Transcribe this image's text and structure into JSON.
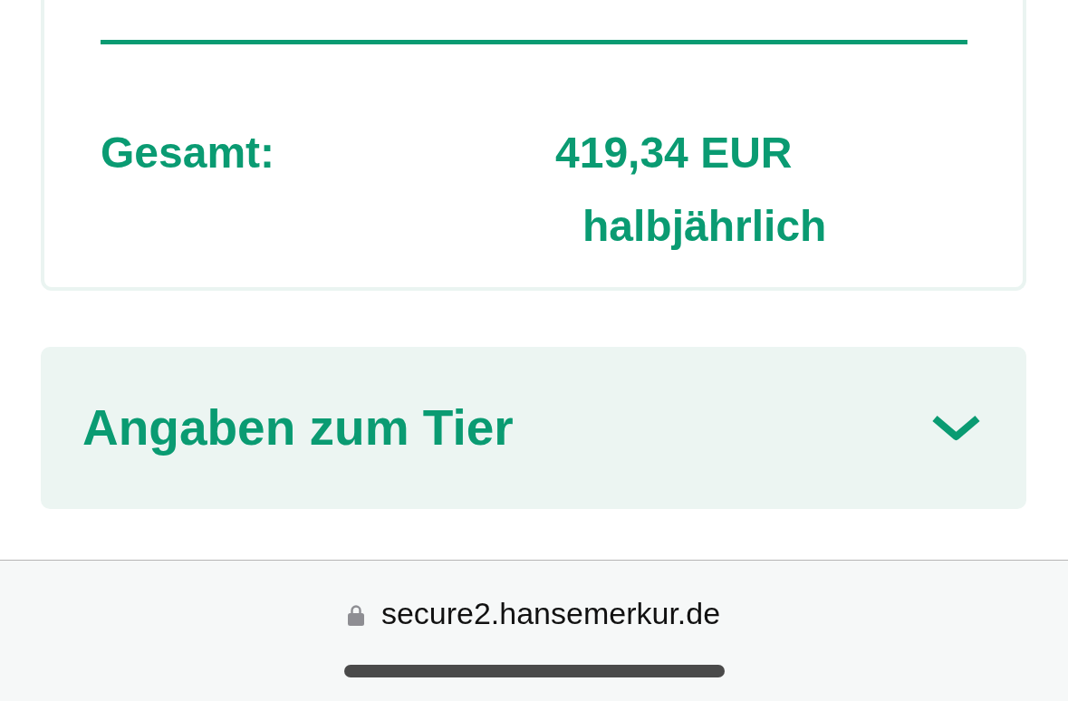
{
  "summary": {
    "total_label": "Gesamt:",
    "total_amount": "419,34 EUR",
    "billing_period": "halbjährlich"
  },
  "accordion": {
    "title": "Angaben zum Tier",
    "expanded": false
  },
  "browser_bar": {
    "url": "secure2.hansemerkur.de",
    "secure": true
  }
}
